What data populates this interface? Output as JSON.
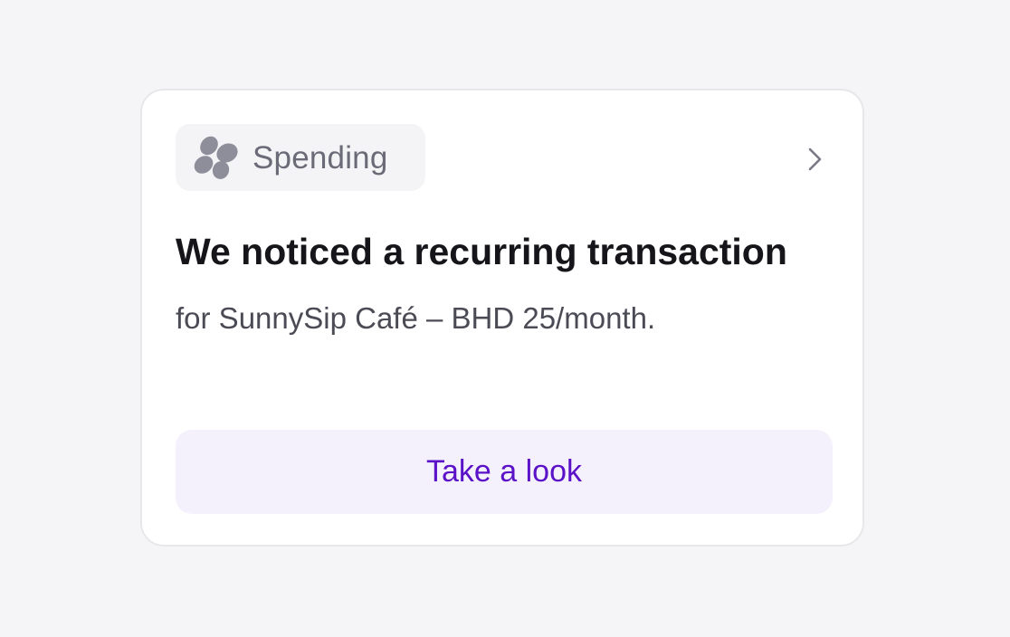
{
  "card": {
    "category": {
      "label": "Spending",
      "icon": "spending-blobs-icon"
    },
    "chevron_icon": "chevron-right-icon",
    "headline": "We noticed a recurring transaction",
    "subtext": "for SunnySip Café – BHD 25/month.",
    "cta_label": "Take a look"
  },
  "colors": {
    "background": "#f5f5f7",
    "card": "#ffffff",
    "chip_background": "#f4f4f6",
    "icon": "#8e8d9a",
    "cta_background": "#f4f1fd",
    "cta_text": "#5a11c7",
    "headline": "#15151a",
    "subtext": "#4b4b55"
  }
}
